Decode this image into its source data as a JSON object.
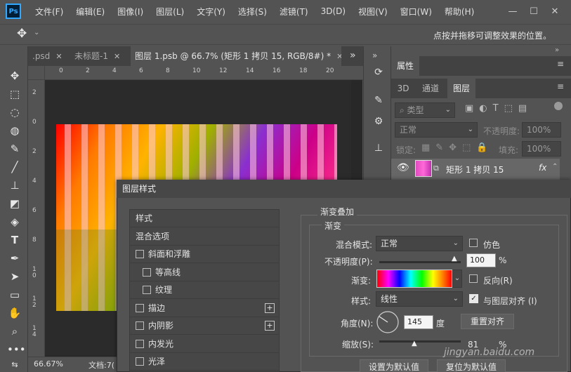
{
  "app": {
    "logo": "Ps"
  },
  "menu": [
    "文件(F)",
    "编辑(E)",
    "图像(I)",
    "图层(L)",
    "文字(Y)",
    "选择(S)",
    "滤镜(T)",
    "3D(D)",
    "视图(V)",
    "窗口(W)",
    "帮助(H)"
  ],
  "window_controls": {
    "minimize": "—",
    "restore": "☐",
    "close": "✕"
  },
  "options_bar": {
    "hint": "点按并拖移可调整效果的位置。",
    "move_icon": "move-icon"
  },
  "tabs": [
    {
      "label": ".psd",
      "close": "✕"
    },
    {
      "label": "未标题-1",
      "close": "✕"
    },
    {
      "label": "图层 1.psb @ 66.7% (矩形 1 拷贝 15, RGB/8#) *",
      "close": "✕"
    }
  ],
  "tab_overflow": "»",
  "ruler": {
    "h": [
      "0",
      "2",
      "4",
      "6",
      "8",
      "10",
      "12",
      "14",
      "16",
      "18",
      "20"
    ],
    "v": [
      "2",
      "0",
      "2",
      "4",
      "6",
      "8",
      "1 0",
      "1 2",
      "1 4"
    ]
  },
  "status": {
    "zoom": "66.67%",
    "doc": "文档:7("
  },
  "properties": {
    "title": "属性"
  },
  "layers_panel": {
    "tabs": [
      "3D",
      "通道",
      "图层"
    ],
    "filter_label": "类型",
    "blend_mode": "正常",
    "opacity_label": "不透明度:",
    "opacity_value": "100%",
    "lock_label": "锁定:",
    "fill_label": "填充:",
    "fill_value": "100%",
    "layer_name": "矩形 1 拷贝 15",
    "fx": "fx"
  },
  "dialog": {
    "title": "图层样式",
    "style_list": [
      {
        "label": "样式",
        "checkbox": false,
        "plus": false,
        "indent": 0
      },
      {
        "label": "混合选项",
        "checkbox": false,
        "plus": false,
        "indent": 0
      },
      {
        "label": "斜面和浮雕",
        "checkbox": true,
        "plus": false,
        "indent": 0
      },
      {
        "label": "等高线",
        "checkbox": true,
        "plus": false,
        "indent": 1
      },
      {
        "label": "纹理",
        "checkbox": true,
        "plus": false,
        "indent": 1
      },
      {
        "label": "描边",
        "checkbox": true,
        "plus": true,
        "indent": 0
      },
      {
        "label": "内阴影",
        "checkbox": true,
        "plus": true,
        "indent": 0
      },
      {
        "label": "内发光",
        "checkbox": true,
        "plus": false,
        "indent": 0
      },
      {
        "label": "光泽",
        "checkbox": true,
        "plus": false,
        "indent": 0
      }
    ],
    "section_title": "渐变叠加",
    "subsection_title": "渐变",
    "blend_mode_label": "混合模式:",
    "blend_mode_value": "正常",
    "dither_label": "仿色",
    "opacity_label": "不透明度(P):",
    "opacity_value": "100",
    "percent": "%",
    "gradient_label": "渐变:",
    "reverse_label": "反向(R)",
    "style_label": "样式:",
    "style_value": "线性",
    "align_label": "与图层对齐 (I)",
    "angle_label": "角度(N):",
    "angle_value": "145",
    "degree": "度",
    "reset_align": "重置对齐",
    "scale_label": "缩放(S):",
    "scale_value": "81",
    "set_default": "设置为默认值",
    "reset_default": "复位为默认值",
    "watermark": "jingyan.baidu.com"
  },
  "chart_data": {
    "stripes_gradient": [
      "#ff0000",
      "#ff7a00",
      "#ffb300",
      "#9fb000",
      "#8a2fd0",
      "#cc0088",
      "#ff2d8a"
    ],
    "accent": "#31a8ff"
  }
}
